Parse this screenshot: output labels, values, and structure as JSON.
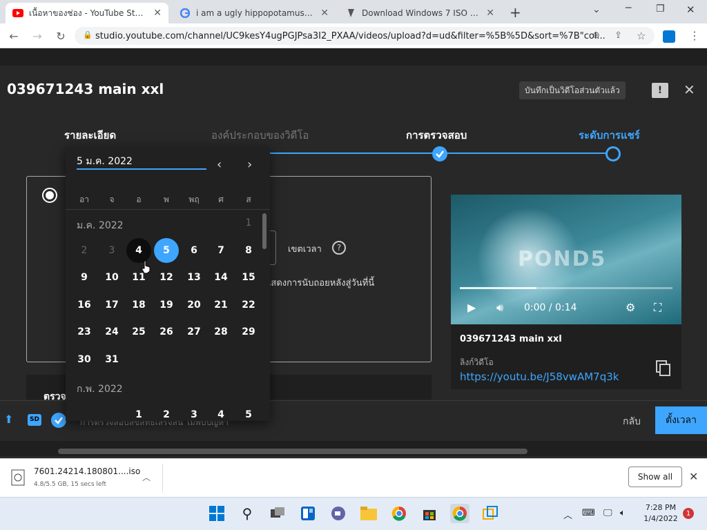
{
  "browser": {
    "tabs": [
      {
        "title": "เนื้อหาของช่อง - YouTube Studio",
        "active": true
      },
      {
        "title": "i am a ugly hippopotamus that n",
        "active": false
      },
      {
        "title": "Download Windows 7 ISO File (U",
        "active": false
      }
    ],
    "new_tab": "+",
    "url": "studio.youtube.com/channel/UC9kesY4ugPGJPsa3I2_PXAA/videos/upload?d=ud&filter=%5B%5D&sort=%7B\"col..."
  },
  "dialog": {
    "title": "039671243 main xxl",
    "saved_chip": "บันทึกเป็นวิดีโอส่วนตัวแล้ว",
    "steps": [
      {
        "label": "รายละเอียด",
        "state": "done"
      },
      {
        "label": "องค์ประกอบของวิดีโอ",
        "state": "done"
      },
      {
        "label": "การตรวจสอบ",
        "state": "done"
      },
      {
        "label": "ระดับการแชร์",
        "state": "current"
      }
    ],
    "timezone_label": "เขตเวลา",
    "countdown_text": "แสดงการนับถอยหลังสู่วันที่นี้",
    "check_hint": "การตรวจสอบลิขสิทธิ์เสร็จสิ้น ไม่พบปัญหา",
    "check_prefix": "ตรวจ",
    "back_label": "กลับ",
    "schedule_label": "ตั้งเวลา"
  },
  "calendar": {
    "date_value": "5 ม.ค. 2022",
    "weekdays": [
      "อา",
      "จ",
      "อ",
      "พ",
      "พฤ",
      "ศ",
      "ส"
    ],
    "month1": "ม.ค. 2022",
    "month2": "ก.พ. 2022",
    "weeks": [
      [
        "",
        "",
        "",
        "",
        "",
        "",
        "1"
      ],
      [
        "2",
        "3",
        "4",
        "5",
        "6",
        "7",
        "8"
      ],
      [
        "9",
        "10",
        "11",
        "12",
        "13",
        "14",
        "15"
      ],
      [
        "16",
        "17",
        "18",
        "19",
        "20",
        "21",
        "22"
      ],
      [
        "23",
        "24",
        "25",
        "26",
        "27",
        "28",
        "29"
      ],
      [
        "30",
        "31",
        "",
        "",
        "",
        "",
        ""
      ]
    ],
    "feb_first_row": [
      "",
      "",
      "1",
      "2",
      "3",
      "4",
      "5"
    ],
    "today": "4",
    "selected": "5",
    "min_day": "4"
  },
  "video": {
    "watermark": "POND5",
    "time": "0:00 / 0:14",
    "progress_fraction": 0.36,
    "title": "039671243 main xxl",
    "link_label": "ลิงก์วิดีโอ",
    "link": "https://youtu.be/J58vwAM7q3k"
  },
  "download": {
    "file": "7601.24214.180801....iso",
    "status": "4.8/5.5 GB, 15 secs left",
    "show_all": "Show all"
  },
  "taskbar": {
    "time": "7:28 PM",
    "date": "1/4/2022",
    "notifications": "1"
  },
  "colors": {
    "accent": "#3ea6ff",
    "bg": "#282828",
    "calendar_bg": "#212121"
  }
}
